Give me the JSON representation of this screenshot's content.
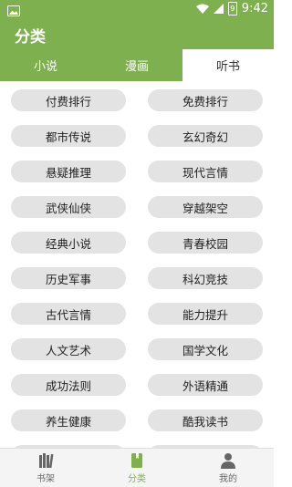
{
  "status": {
    "time": "9:42",
    "battery": "9"
  },
  "header": {
    "title": "分类"
  },
  "tabs": [
    {
      "label": "小说",
      "active": false
    },
    {
      "label": "漫画",
      "active": false
    },
    {
      "label": "听书",
      "active": true
    }
  ],
  "categories": [
    [
      "付费排行",
      "免费排行"
    ],
    [
      "都市传说",
      "玄幻奇幻"
    ],
    [
      "悬疑推理",
      "现代言情"
    ],
    [
      "武侠仙侠",
      "穿越架空"
    ],
    [
      "经典小说",
      "青春校园"
    ],
    [
      "历史军事",
      "科幻竞技"
    ],
    [
      "古代言情",
      "能力提升"
    ],
    [
      "人文艺术",
      "国学文化"
    ],
    [
      "成功法则",
      "外语精通"
    ],
    [
      "养生健康",
      "酷我读书"
    ],
    [
      "",
      ""
    ]
  ],
  "bottom_nav": [
    {
      "label": "书架",
      "icon": "bookshelf-icon",
      "active": false
    },
    {
      "label": "分类",
      "icon": "category-book-icon",
      "active": true
    },
    {
      "label": "我的",
      "icon": "person-icon",
      "active": false
    }
  ],
  "colors": {
    "accent": "#7fb04f",
    "pill": "#e3e3e3"
  }
}
